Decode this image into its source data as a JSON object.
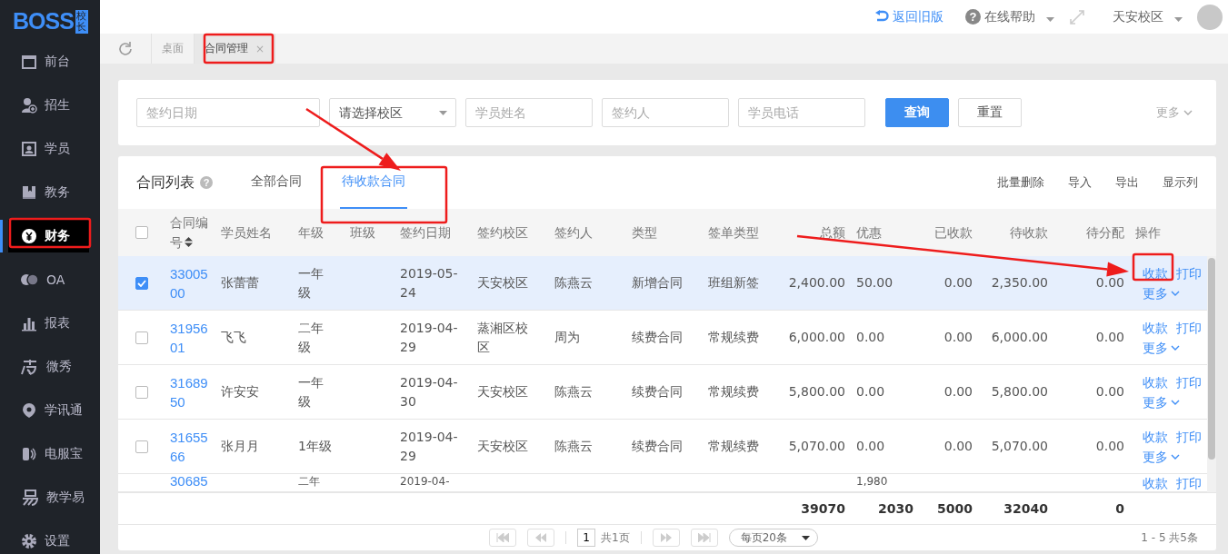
{
  "logo": {
    "text": "BOSS",
    "tag": "校长"
  },
  "header": {
    "back_link": "返回旧版",
    "help_icon": "?",
    "help": "在线帮助",
    "campus": "天安校区"
  },
  "page_tabs": [
    {
      "label": "桌面",
      "selected": false
    },
    {
      "label": "合同管理",
      "selected": true,
      "close": "×"
    }
  ],
  "sidebar": {
    "items": [
      {
        "label": "前台",
        "selected": false
      },
      {
        "label": "招生",
        "selected": false
      },
      {
        "label": "学员",
        "selected": false
      },
      {
        "label": "教务",
        "selected": false
      },
      {
        "label": "财务",
        "selected": true
      },
      {
        "label": "OA",
        "selected": false
      },
      {
        "label": "报表",
        "selected": false
      },
      {
        "label": "微秀",
        "selected": false
      },
      {
        "label": "学讯通",
        "selected": false
      },
      {
        "label": "电服宝",
        "selected": false
      },
      {
        "label": "教学易",
        "selected": false
      },
      {
        "label": "设置",
        "selected": false
      }
    ]
  },
  "filters": {
    "fields": [
      {
        "placeholder": "签约日期",
        "kind": "input"
      },
      {
        "placeholder": "请选择校区",
        "kind": "select"
      },
      {
        "placeholder": "学员姓名",
        "kind": "input"
      },
      {
        "placeholder": "签约人",
        "kind": "input"
      },
      {
        "placeholder": "学员电话",
        "kind": "input"
      }
    ],
    "buttons": [
      {
        "label": "查询",
        "kind": "primary"
      },
      {
        "label": "重置",
        "kind": "default"
      }
    ],
    "more": "更多"
  },
  "contracts": {
    "title": "合同列表",
    "help_icon": "?",
    "select_all": {
      "checked": false
    },
    "tabs": [
      {
        "label": "全部合同",
        "selected": false
      },
      {
        "label": "待收款合同",
        "selected": true
      }
    ],
    "actions": [
      "批量删除",
      "导入",
      "导出",
      "显示列"
    ],
    "columns": [
      {
        "label": "合同编号",
        "kind": "link",
        "sortable": true
      },
      {
        "label": "学员姓名",
        "kind": "text",
        "sortable": false
      },
      {
        "label": "年级",
        "kind": "text",
        "sortable": false
      },
      {
        "label": "班级",
        "kind": "text",
        "sortable": false
      },
      {
        "label": "签约日期",
        "kind": "text",
        "sortable": false
      },
      {
        "label": "签约校区",
        "kind": "text",
        "sortable": false
      },
      {
        "label": "签约人",
        "kind": "text",
        "sortable": false
      },
      {
        "label": "类型",
        "kind": "text",
        "sortable": false
      },
      {
        "label": "签单类型",
        "kind": "text",
        "sortable": false
      },
      {
        "label": "总额",
        "kind": "number",
        "sortable": false
      },
      {
        "label": "优惠",
        "kind": "text",
        "sortable": false
      },
      {
        "label": "已收款",
        "kind": "number",
        "sortable": false
      },
      {
        "label": "待收款",
        "kind": "number",
        "sortable": false
      },
      {
        "label": "待分配",
        "kind": "number",
        "sortable": false
      },
      {
        "label": "操作",
        "kind": "actions",
        "sortable": false
      }
    ],
    "rows": [
      {
        "kind": "full",
        "selected": true,
        "cells": [
          "3300500",
          "张蕾蕾",
          "一年级",
          null,
          "2019-05-24",
          "天安校区",
          "陈燕云",
          "新增合同",
          "班组新签",
          "2,400.00",
          "50.00",
          "0.00",
          "2,350.00",
          "0.00"
        ],
        "actions": [
          {
            "label": "收款",
            "kind": "link"
          },
          {
            "label": "打印",
            "kind": "link"
          },
          {
            "label": "更多",
            "kind": "menu"
          }
        ]
      },
      {
        "kind": "full",
        "selected": false,
        "cells": [
          "3195601",
          "飞飞",
          "二年级",
          null,
          "2019-04-29",
          "蒸湘区校区",
          "周为",
          "续费合同",
          "常规续费",
          "6,000.00",
          "0.00",
          "0.00",
          "6,000.00",
          "0.00"
        ],
        "actions": [
          {
            "label": "收款",
            "kind": "link"
          },
          {
            "label": "打印",
            "kind": "link"
          },
          {
            "label": "更多",
            "kind": "menu"
          }
        ]
      },
      {
        "kind": "full",
        "selected": false,
        "cells": [
          "3168950",
          "许安安",
          "一年级",
          null,
          "2019-04-30",
          "天安校区",
          "陈燕云",
          "续费合同",
          "常规续费",
          "5,800.00",
          "0.00",
          "0.00",
          "5,800.00",
          "0.00"
        ],
        "actions": [
          {
            "label": "收款",
            "kind": "link"
          },
          {
            "label": "打印",
            "kind": "link"
          },
          {
            "label": "更多",
            "kind": "menu"
          }
        ]
      },
      {
        "kind": "full",
        "selected": false,
        "cells": [
          "3165566",
          "张月月",
          "1年级",
          null,
          "2019-04-29",
          "天安校区",
          "陈燕云",
          "续费合同",
          "常规续费",
          "5,070.00",
          "0.00",
          "0.00",
          "5,070.00",
          "0.00"
        ],
        "actions": [
          {
            "label": "收款",
            "kind": "link"
          },
          {
            "label": "打印",
            "kind": "link"
          },
          {
            "label": "更多",
            "kind": "menu"
          }
        ]
      },
      {
        "kind": "partial",
        "cells": [
          "30685",
          null,
          "二年",
          null,
          "2019-04-",
          null,
          null,
          null,
          null,
          null,
          "1,980",
          null,
          null,
          null
        ],
        "actions": [
          {
            "label": "收款",
            "kind": "link"
          },
          {
            "label": "打印",
            "kind": "link"
          }
        ]
      }
    ],
    "totals": [
      "39070",
      "2030",
      "5000",
      "32040",
      "0"
    ],
    "pagination": {
      "page": "1",
      "total_pages": "共1页",
      "page_size": "每页20条",
      "summary": "1 - 5 共5条"
    }
  }
}
